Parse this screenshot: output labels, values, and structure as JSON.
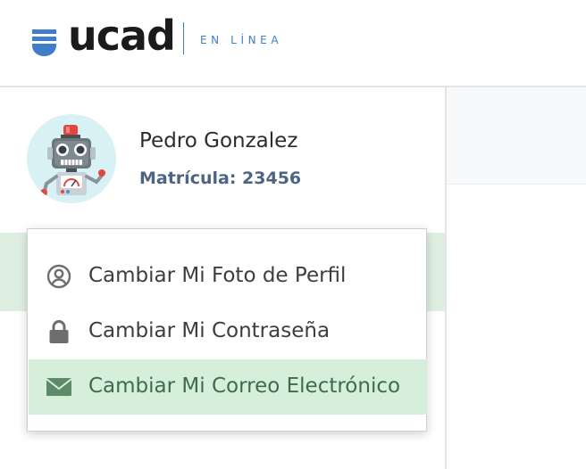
{
  "brand": {
    "logo_text": "ucad",
    "tagline": "EN LÍNEA",
    "accent_color": "#3f7ec8"
  },
  "user": {
    "name": "Pedro Gonzalez",
    "matricula": "Matrícula: 23456",
    "avatar_icon": "robot-avatar-icon"
  },
  "profile_menu": {
    "items": [
      {
        "label": "Cambiar Mi Foto de Perfil",
        "icon": "user-circle-icon",
        "selected": false
      },
      {
        "label": "Cambiar Mi Contraseña",
        "icon": "lock-icon",
        "selected": false
      },
      {
        "label": "Cambiar Mi Correo Electrónico",
        "icon": "envelope-icon",
        "selected": true
      }
    ]
  },
  "colors": {
    "highlight_bg": "#d6efdb",
    "highlight_text": "#3f6a4d",
    "matricula_text": "#4e6484"
  }
}
